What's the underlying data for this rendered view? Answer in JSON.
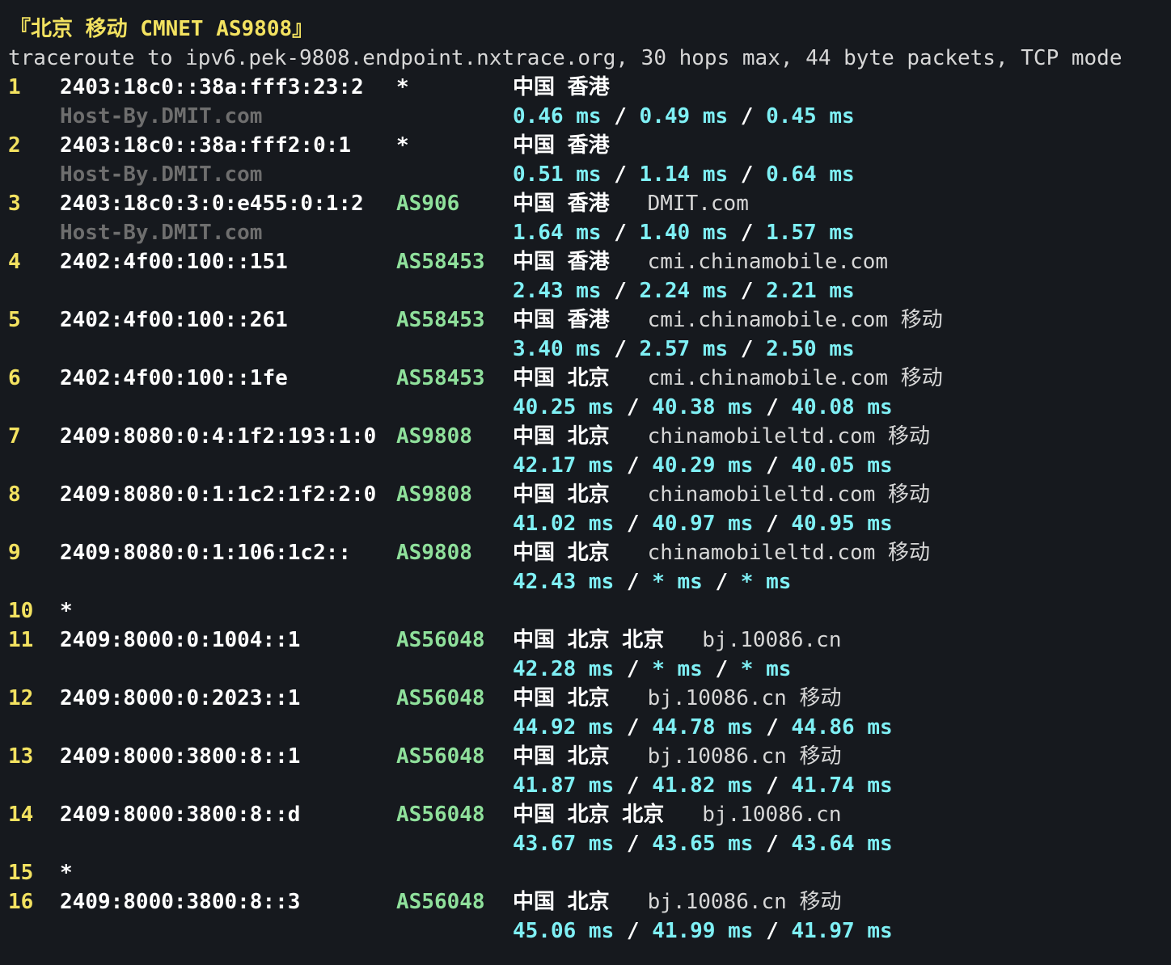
{
  "header": {
    "title": "『北京 移动 CMNET AS9808』",
    "command": "traceroute to ipv6.pek-9808.endpoint.nxtrace.org, 30 hops max, 44 byte packets, TCP mode"
  },
  "colors": {
    "background": "#16191e",
    "hop_number": "#f3e260",
    "ip": "#ffffff",
    "hostname": "#6e6e6e",
    "asn": "#8fe09b",
    "timing": "#7ff0f5"
  },
  "hops": [
    {
      "num": "1",
      "ip": "2403:18c0::38a:fff3:23:2",
      "asn": "*",
      "geo": "中国 香港",
      "org": "",
      "hostname": "Host-By.DMIT.com",
      "times": [
        "0.46 ms",
        "0.49 ms",
        "0.45 ms"
      ]
    },
    {
      "num": "2",
      "ip": "2403:18c0::38a:fff2:0:1",
      "asn": "*",
      "geo": "中国 香港",
      "org": "",
      "hostname": "Host-By.DMIT.com",
      "times": [
        "0.51 ms",
        "1.14 ms",
        "0.64 ms"
      ]
    },
    {
      "num": "3",
      "ip": "2403:18c0:3:0:e455:0:1:2",
      "asn": "AS906",
      "geo": "中国 香港",
      "org": "DMIT.com",
      "hostname": "Host-By.DMIT.com",
      "times": [
        "1.64 ms",
        "1.40 ms",
        "1.57 ms"
      ]
    },
    {
      "num": "4",
      "ip": "2402:4f00:100::151",
      "asn": "AS58453",
      "geo": "中国 香港",
      "org": "cmi.chinamobile.com",
      "hostname": "",
      "times": [
        "2.43 ms",
        "2.24 ms",
        "2.21 ms"
      ]
    },
    {
      "num": "5",
      "ip": "2402:4f00:100::261",
      "asn": "AS58453",
      "geo": "中国 香港",
      "org": "cmi.chinamobile.com 移动",
      "hostname": "",
      "times": [
        "3.40 ms",
        "2.57 ms",
        "2.50 ms"
      ]
    },
    {
      "num": "6",
      "ip": "2402:4f00:100::1fe",
      "asn": "AS58453",
      "geo": "中国 北京",
      "org": "cmi.chinamobile.com 移动",
      "hostname": "",
      "times": [
        "40.25 ms",
        "40.38 ms",
        "40.08 ms"
      ]
    },
    {
      "num": "7",
      "ip": "2409:8080:0:4:1f2:193:1:0",
      "asn": "AS9808",
      "geo": "中国 北京",
      "org": "chinamobileltd.com 移动",
      "hostname": "",
      "times": [
        "42.17 ms",
        "40.29 ms",
        "40.05 ms"
      ]
    },
    {
      "num": "8",
      "ip": "2409:8080:0:1:1c2:1f2:2:0",
      "asn": "AS9808",
      "geo": "中国 北京",
      "org": "chinamobileltd.com 移动",
      "hostname": "",
      "times": [
        "41.02 ms",
        "40.97 ms",
        "40.95 ms"
      ]
    },
    {
      "num": "9",
      "ip": "2409:8080:0:1:106:1c2::",
      "asn": "AS9808",
      "geo": "中国 北京",
      "org": "chinamobileltd.com 移动",
      "hostname": "",
      "times": [
        "42.43 ms",
        "* ms",
        "* ms"
      ]
    },
    {
      "num": "10",
      "ip": "*",
      "asn": "",
      "geo": "",
      "org": "",
      "hostname": "",
      "times": []
    },
    {
      "num": "11",
      "ip": "2409:8000:0:1004::1",
      "asn": "AS56048",
      "geo": "中国 北京 北京",
      "org": "bj.10086.cn",
      "hostname": "",
      "times": [
        "42.28 ms",
        "* ms",
        "* ms"
      ]
    },
    {
      "num": "12",
      "ip": "2409:8000:0:2023::1",
      "asn": "AS56048",
      "geo": "中国 北京",
      "org": "bj.10086.cn 移动",
      "hostname": "",
      "times": [
        "44.92 ms",
        "44.78 ms",
        "44.86 ms"
      ]
    },
    {
      "num": "13",
      "ip": "2409:8000:3800:8::1",
      "asn": "AS56048",
      "geo": "中国 北京",
      "org": "bj.10086.cn 移动",
      "hostname": "",
      "times": [
        "41.87 ms",
        "41.82 ms",
        "41.74 ms"
      ]
    },
    {
      "num": "14",
      "ip": "2409:8000:3800:8::d",
      "asn": "AS56048",
      "geo": "中国 北京 北京",
      "org": "bj.10086.cn",
      "hostname": "",
      "times": [
        "43.67 ms",
        "43.65 ms",
        "43.64 ms"
      ]
    },
    {
      "num": "15",
      "ip": "*",
      "asn": "",
      "geo": "",
      "org": "",
      "hostname": "",
      "times": []
    },
    {
      "num": "16",
      "ip": "2409:8000:3800:8::3",
      "asn": "AS56048",
      "geo": "中国 北京",
      "org": "bj.10086.cn 移动",
      "hostname": "",
      "times": [
        "45.06 ms",
        "41.99 ms",
        "41.97 ms"
      ]
    }
  ]
}
